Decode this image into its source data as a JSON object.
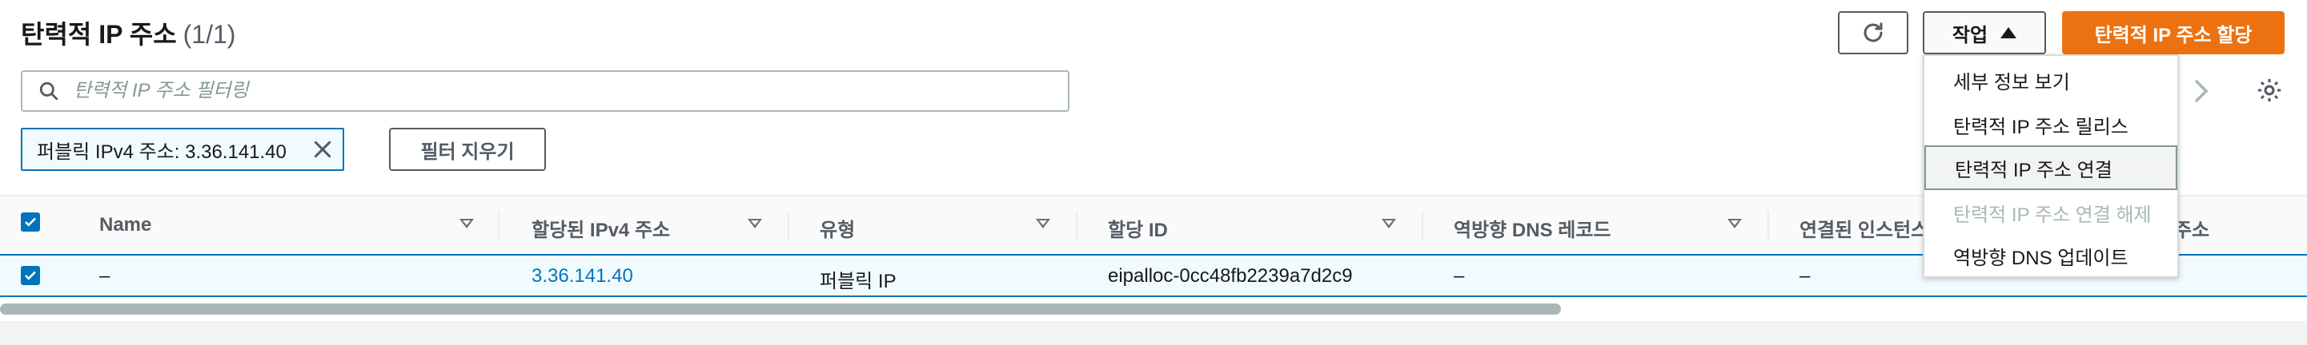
{
  "header": {
    "title": "탄력적 IP 주소",
    "count": "(1/1)",
    "actions_label": "작업",
    "allocate_label": "탄력적 IP 주소 할당"
  },
  "search": {
    "placeholder": "탄력적 IP 주소 필터링",
    "value": ""
  },
  "filter_token": {
    "key": "퍼블릭 IPv4 주소",
    "value": "3.36.141.40",
    "text": "퍼블릭 IPv4 주소: 3.36.141.40"
  },
  "clear_filters_label": "필터 지우기",
  "table": {
    "columns": [
      "Name",
      "할당된 IPv4 주소",
      "유형",
      "할당 ID",
      "역방향 DNS 레코드",
      "연결된 인스턴스",
      "프라이빗 IP 주소"
    ],
    "rows": [
      {
        "name": "–",
        "ipv4": "3.36.141.40",
        "type": "퍼블릭 IP",
        "allocation_id": "eipalloc-0cc48fb2239a7d2c9",
        "reverse_dns": "–",
        "instance": "–",
        "private_ip": "–"
      }
    ]
  },
  "actions_menu": {
    "items": [
      {
        "label": "세부 정보 보기",
        "state": "normal"
      },
      {
        "label": "탄력적 IP 주소 릴리스",
        "state": "normal"
      },
      {
        "label": "탄력적 IP 주소 연결",
        "state": "active"
      },
      {
        "label": "탄력적 IP 주소 연결 해제",
        "state": "disabled"
      },
      {
        "label": "역방향 DNS 업데이트",
        "state": "normal"
      }
    ]
  },
  "colors": {
    "primary": "#ec7211",
    "link": "#0073bb",
    "selected_row": "#f1faff"
  },
  "icons": [
    "refresh-icon",
    "caret-up-icon",
    "search-icon",
    "close-icon",
    "chevron-right-icon",
    "gear-icon",
    "sort-icon",
    "checkbox-checked-icon"
  ]
}
